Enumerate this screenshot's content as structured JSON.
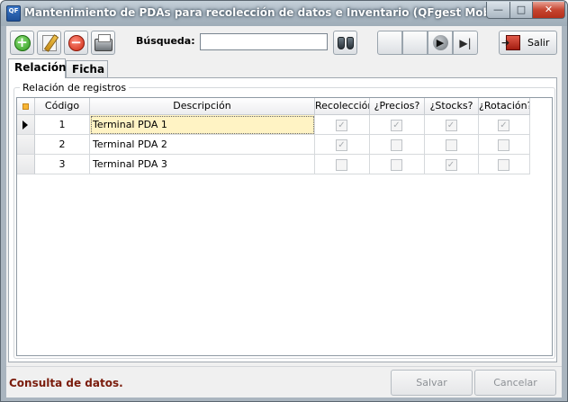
{
  "window": {
    "app_icon_text": "QF",
    "title": "Mantenimiento de PDAs para recolección de datos e Inventario (QFgest Mobile)",
    "minimize_glyph": "—",
    "maximize_glyph": "□",
    "close_glyph": "✕"
  },
  "toolbar": {
    "add_glyph": "+",
    "delete_glyph": "−",
    "search_label": "Búsqueda:",
    "search_value": "",
    "nav_first": "",
    "nav_prev": "",
    "nav_next": "▶",
    "nav_last": "▶|",
    "exit_label": "Salir"
  },
  "tabs": [
    {
      "label": "Relación",
      "active": true
    },
    {
      "label": "Ficha",
      "active": false
    }
  ],
  "group": {
    "title": "Relación de registros"
  },
  "grid": {
    "columns": [
      "Código",
      "Descripción",
      "Recolección",
      "¿Precios?",
      "¿Stocks?",
      "¿Rotación?"
    ],
    "rows": [
      {
        "codigo": "1",
        "descripcion": "Terminal PDA 1",
        "recoleccion": true,
        "precios": true,
        "stocks": true,
        "rotacion": true,
        "current": true
      },
      {
        "codigo": "2",
        "descripcion": "Terminal PDA 2",
        "recoleccion": true,
        "precios": false,
        "stocks": false,
        "rotacion": false,
        "current": false
      },
      {
        "codigo": "3",
        "descripcion": "Terminal PDA 3",
        "recoleccion": false,
        "precios": false,
        "stocks": true,
        "rotacion": false,
        "current": false
      }
    ]
  },
  "status": {
    "message": "Consulta de datos.",
    "save_label": "Salvar",
    "cancel_label": "Cancelar"
  },
  "colors": {
    "status_text": "#7a1c0c",
    "focused_cell": "#fff3c4",
    "close_button": "#c64530"
  }
}
